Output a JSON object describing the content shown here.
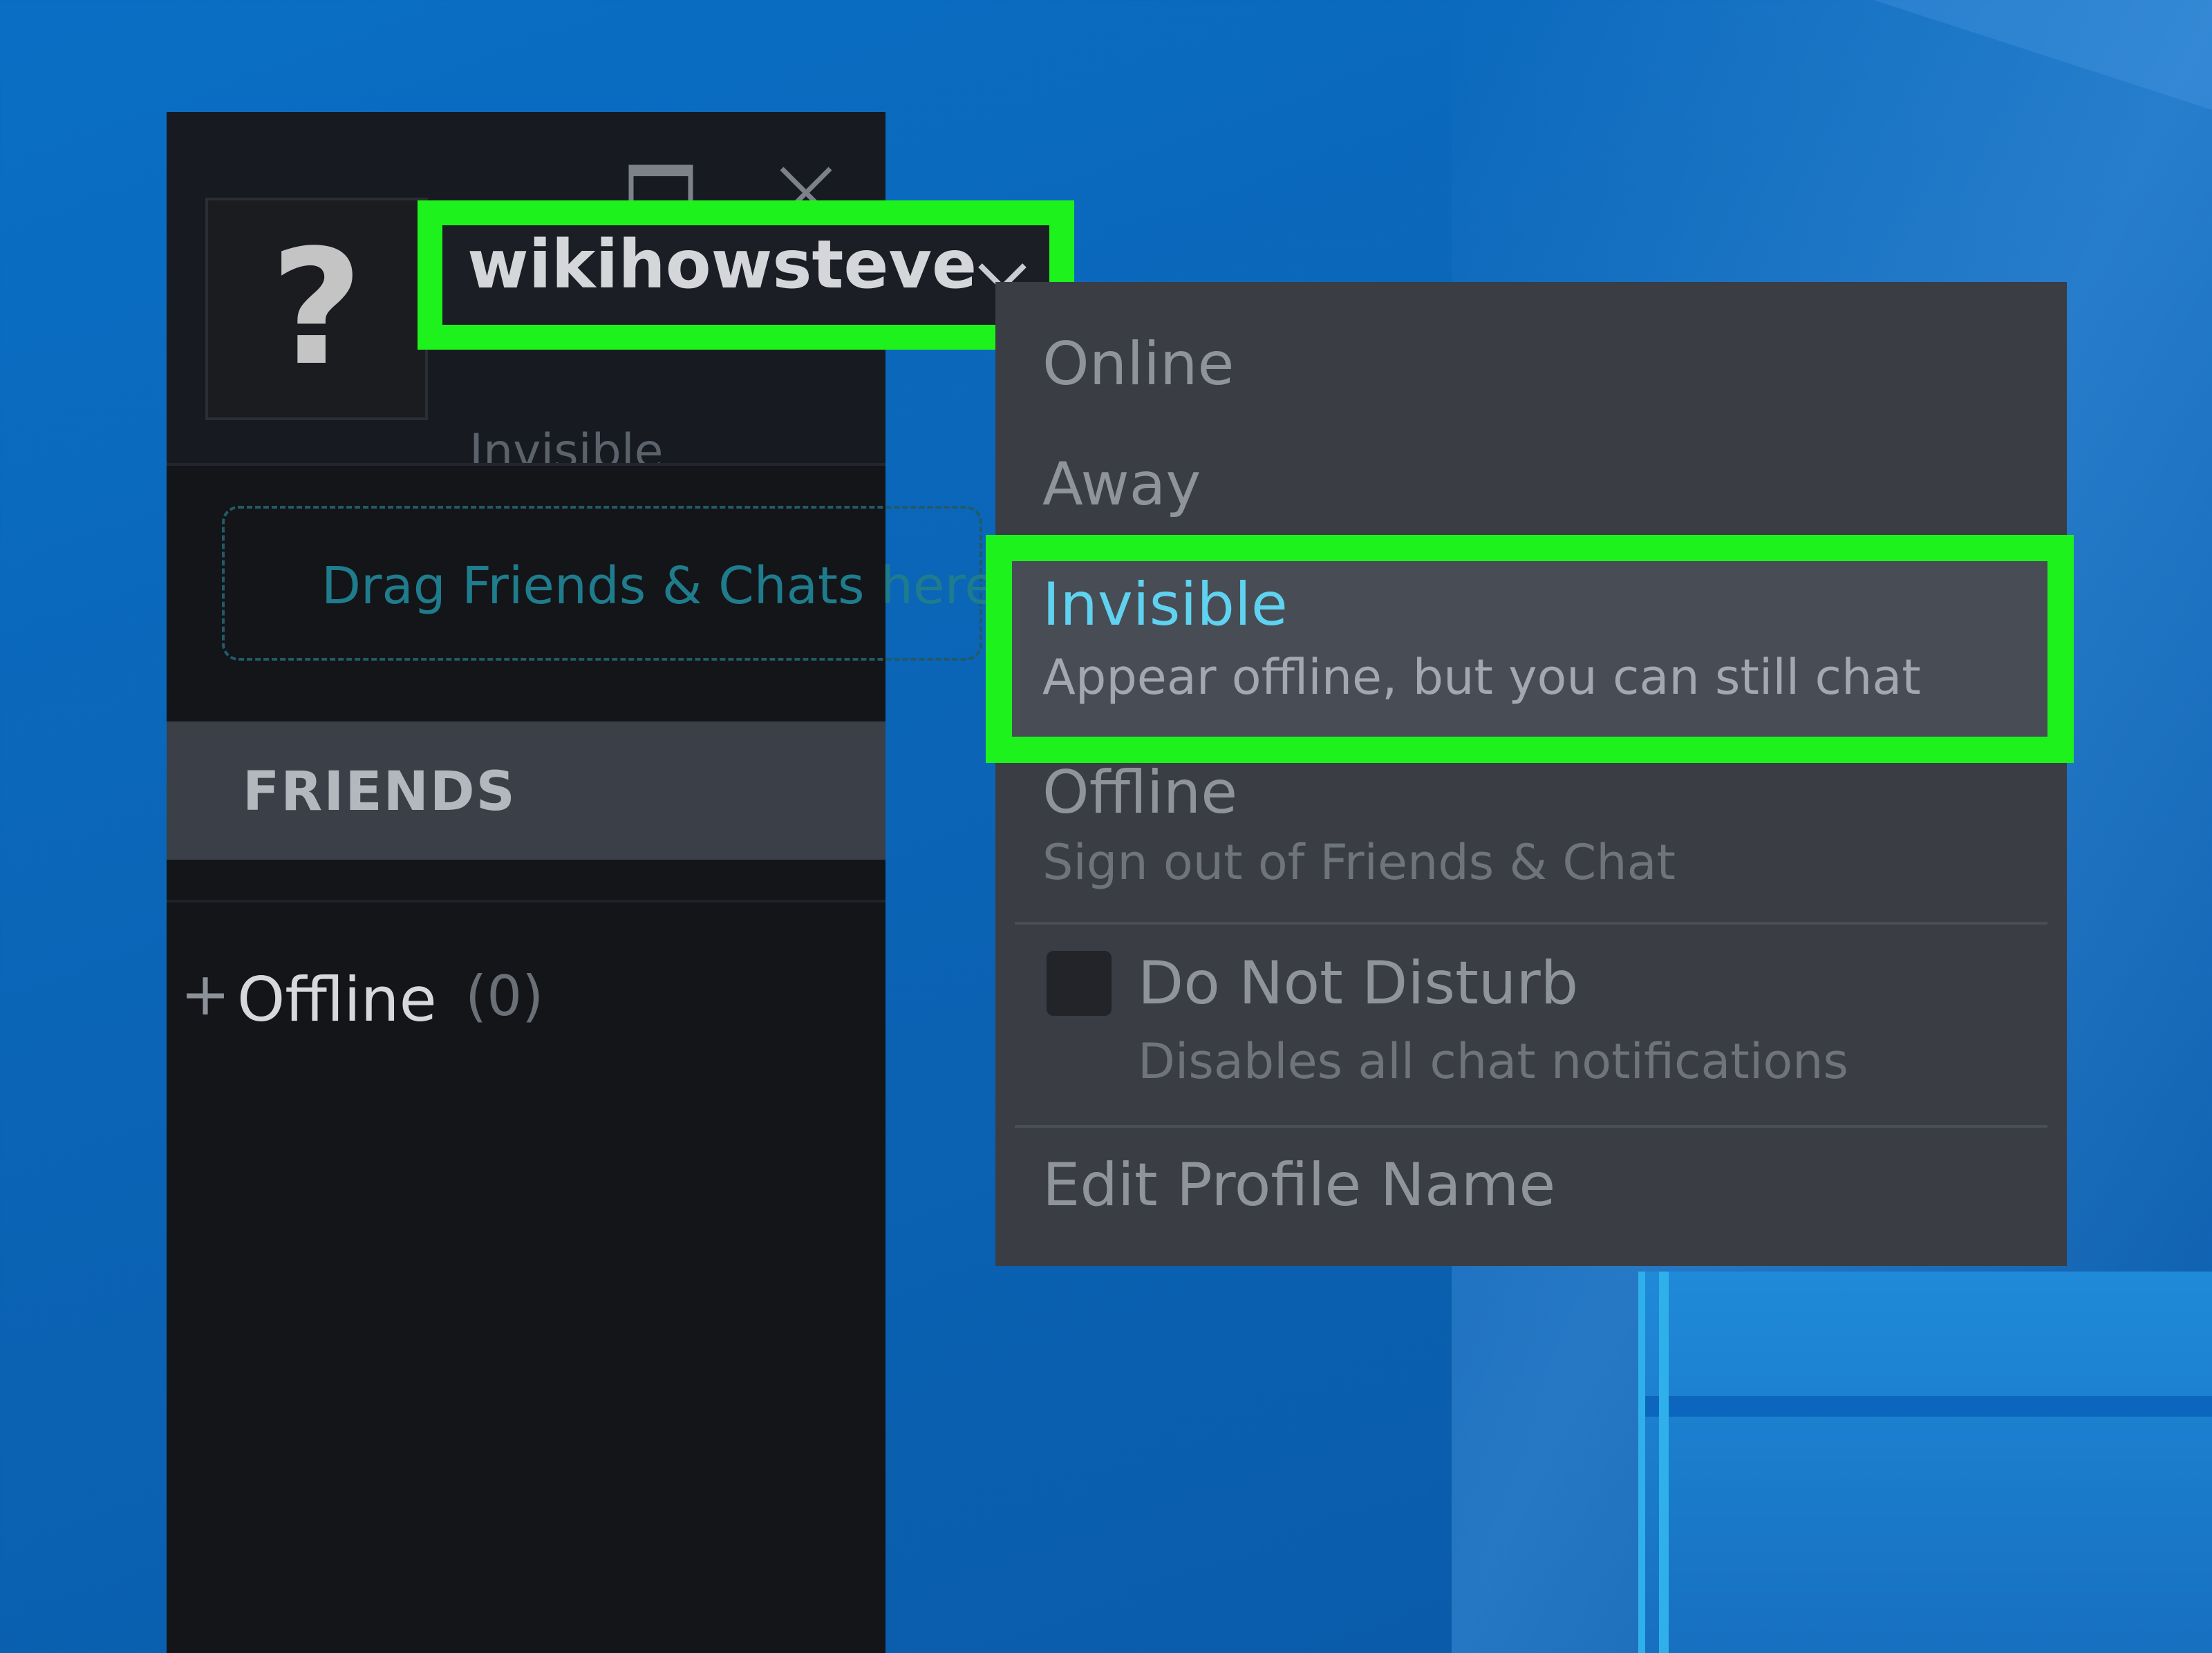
{
  "window": {
    "username": "wikihowsteve",
    "status": "Invisible",
    "avatar_glyph": "?",
    "drop_zone_text": "Drag Friends & Chats here",
    "friends_header": "FRIENDS",
    "groups": [
      {
        "toggle": "+",
        "name": "Offline",
        "count": "(0)"
      }
    ]
  },
  "status_menu": {
    "items": [
      {
        "label": "Online"
      },
      {
        "label": "Away"
      },
      {
        "label": "Invisible",
        "description": "Appear offline, but you can still chat",
        "selected": true
      },
      {
        "label": "Offline",
        "description": "Sign out of Friends & Chat"
      },
      {
        "label": "Do Not Disturb",
        "description": "Disables all chat notifications",
        "checked": false
      },
      {
        "label": "Edit Profile Name"
      }
    ]
  },
  "colors": {
    "highlight": "#1df21d",
    "invisible_accent": "#5fd2f0",
    "window_bg": "#131519",
    "menu_bg": "#3a3d44"
  },
  "icons": [
    "minimize-icon",
    "maximize-icon",
    "close-icon",
    "chevron-down-icon",
    "plus-icon",
    "checkbox-icon"
  ]
}
